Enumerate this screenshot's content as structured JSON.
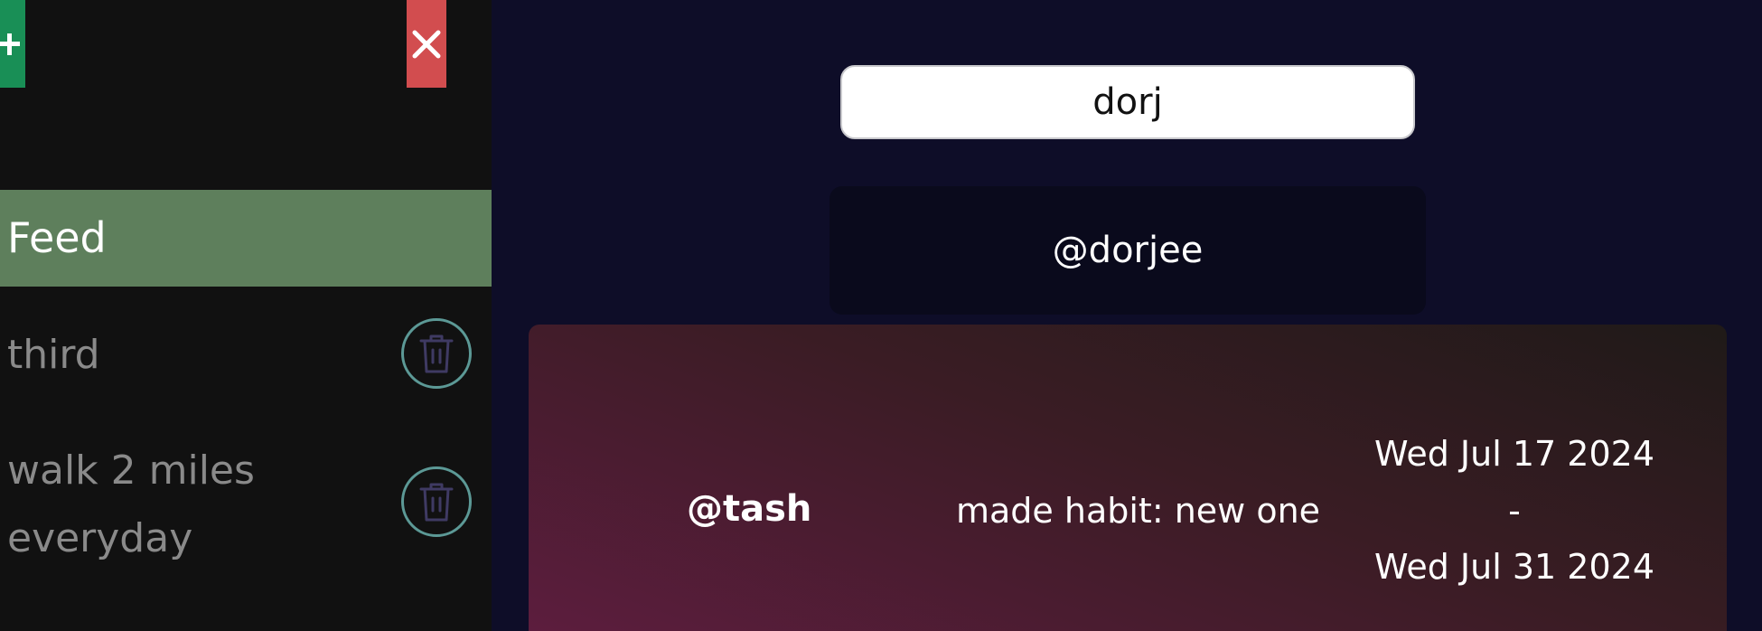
{
  "sidebar": {
    "add_label": "+",
    "close_label": "×",
    "nav": {
      "feed_label": "Feed"
    },
    "habits": [
      {
        "label_lines": [
          "third"
        ]
      },
      {
        "label_lines": [
          "walk 2 miles",
          "everyday"
        ]
      }
    ]
  },
  "search": {
    "value": "dorj",
    "results": [
      "@dorjee"
    ]
  },
  "feed": {
    "items": [
      {
        "user": "@tash",
        "action": "made habit: new one",
        "start_date": "Wed Jul 17 2024",
        "separator": "-",
        "end_date": "Wed Jul 31 2024"
      }
    ]
  },
  "colors": {
    "add_button": "#198f56",
    "close_button": "#d24d4f",
    "feed_active": "#5e7f5c",
    "trash_ring": "#5c9996",
    "page_background": "#0e0d28"
  }
}
